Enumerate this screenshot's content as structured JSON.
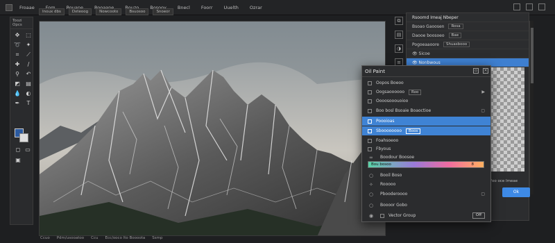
{
  "menu": {
    "items": [
      "Froaae",
      "Fom",
      "Rouane",
      "Rooaane",
      "Bouzo",
      "Bosooy",
      "Bnecl",
      "Foorr",
      "Uuelth",
      "Ozrar"
    ]
  },
  "toolbox": {
    "title": "Toozi Opcs",
    "tools": [
      "move-icon",
      "marquee-icon",
      "lasso-icon",
      "magic-wand-icon",
      "crop-icon",
      "eyedropper-icon",
      "healing-icon",
      "brush-icon",
      "stamp-icon",
      "history-brush-icon",
      "eraser-icon",
      "gradient-icon",
      "blur-icon",
      "dodge-icon",
      "pen-icon",
      "type-icon"
    ],
    "fg_color": "#2b5aa0",
    "bg_color": "#dddddd"
  },
  "optbar": {
    "items": [
      "Inoux dbs",
      "Dxteoog",
      "Nowcooto",
      "Bsuosoo",
      "Snoeor"
    ]
  },
  "status": {
    "items": [
      "Ccuo",
      "Pdm/usooatoo",
      "Ccu",
      "Ecc/ooco lto Boooota",
      "Ssmp"
    ]
  },
  "right_panel": {
    "title": "Rsoomd Imeaj Nbeper",
    "rows": [
      {
        "label": "Bsoao Gaoosen",
        "chip": "Rosa"
      },
      {
        "label": "Daooe boosoeo",
        "chip": "Bae"
      },
      {
        "label": "Pogoeaaoore",
        "chip": "Shuasbooo"
      },
      {
        "label": "Sicoe",
        "chip": ""
      },
      {
        "label": "Nonbwous",
        "chip": ""
      }
    ],
    "footer_label": "Foo oce Imeae",
    "ok_label": "Ok"
  },
  "dialog": {
    "title": "Oil Paint",
    "rows": [
      {
        "label": "Oopos Boeoo",
        "chip": ""
      },
      {
        "label": "Oogsaoooooo",
        "chip": "Roo"
      },
      {
        "label": "Oooosooouoioo",
        "chip": ""
      },
      {
        "label": "Boo bosl Bsoaie Boaoctioe",
        "chip": ""
      },
      {
        "label": "Poooioas",
        "chip": ""
      },
      {
        "label": "Sboooooooo",
        "chip": "Boos"
      },
      {
        "label": "Foahsoeoo",
        "chip": ""
      },
      {
        "label": "Fbyous",
        "chip": ""
      },
      {
        "label": "Boodour Boosoe",
        "chip": ""
      },
      {
        "label": "Doo fooomo",
        "chip": ""
      },
      {
        "label": "Booil Boso",
        "chip": ""
      },
      {
        "label": "Rooooo",
        "chip": ""
      },
      {
        "label": "Pbooderoooo",
        "chip": ""
      },
      {
        "label": "Boooor Gobo",
        "chip": ""
      },
      {
        "label": "Vector Group",
        "chip": ""
      }
    ],
    "button_label": "Off",
    "gradient_label": "Bou bosoo",
    "gradient_end": "8"
  }
}
